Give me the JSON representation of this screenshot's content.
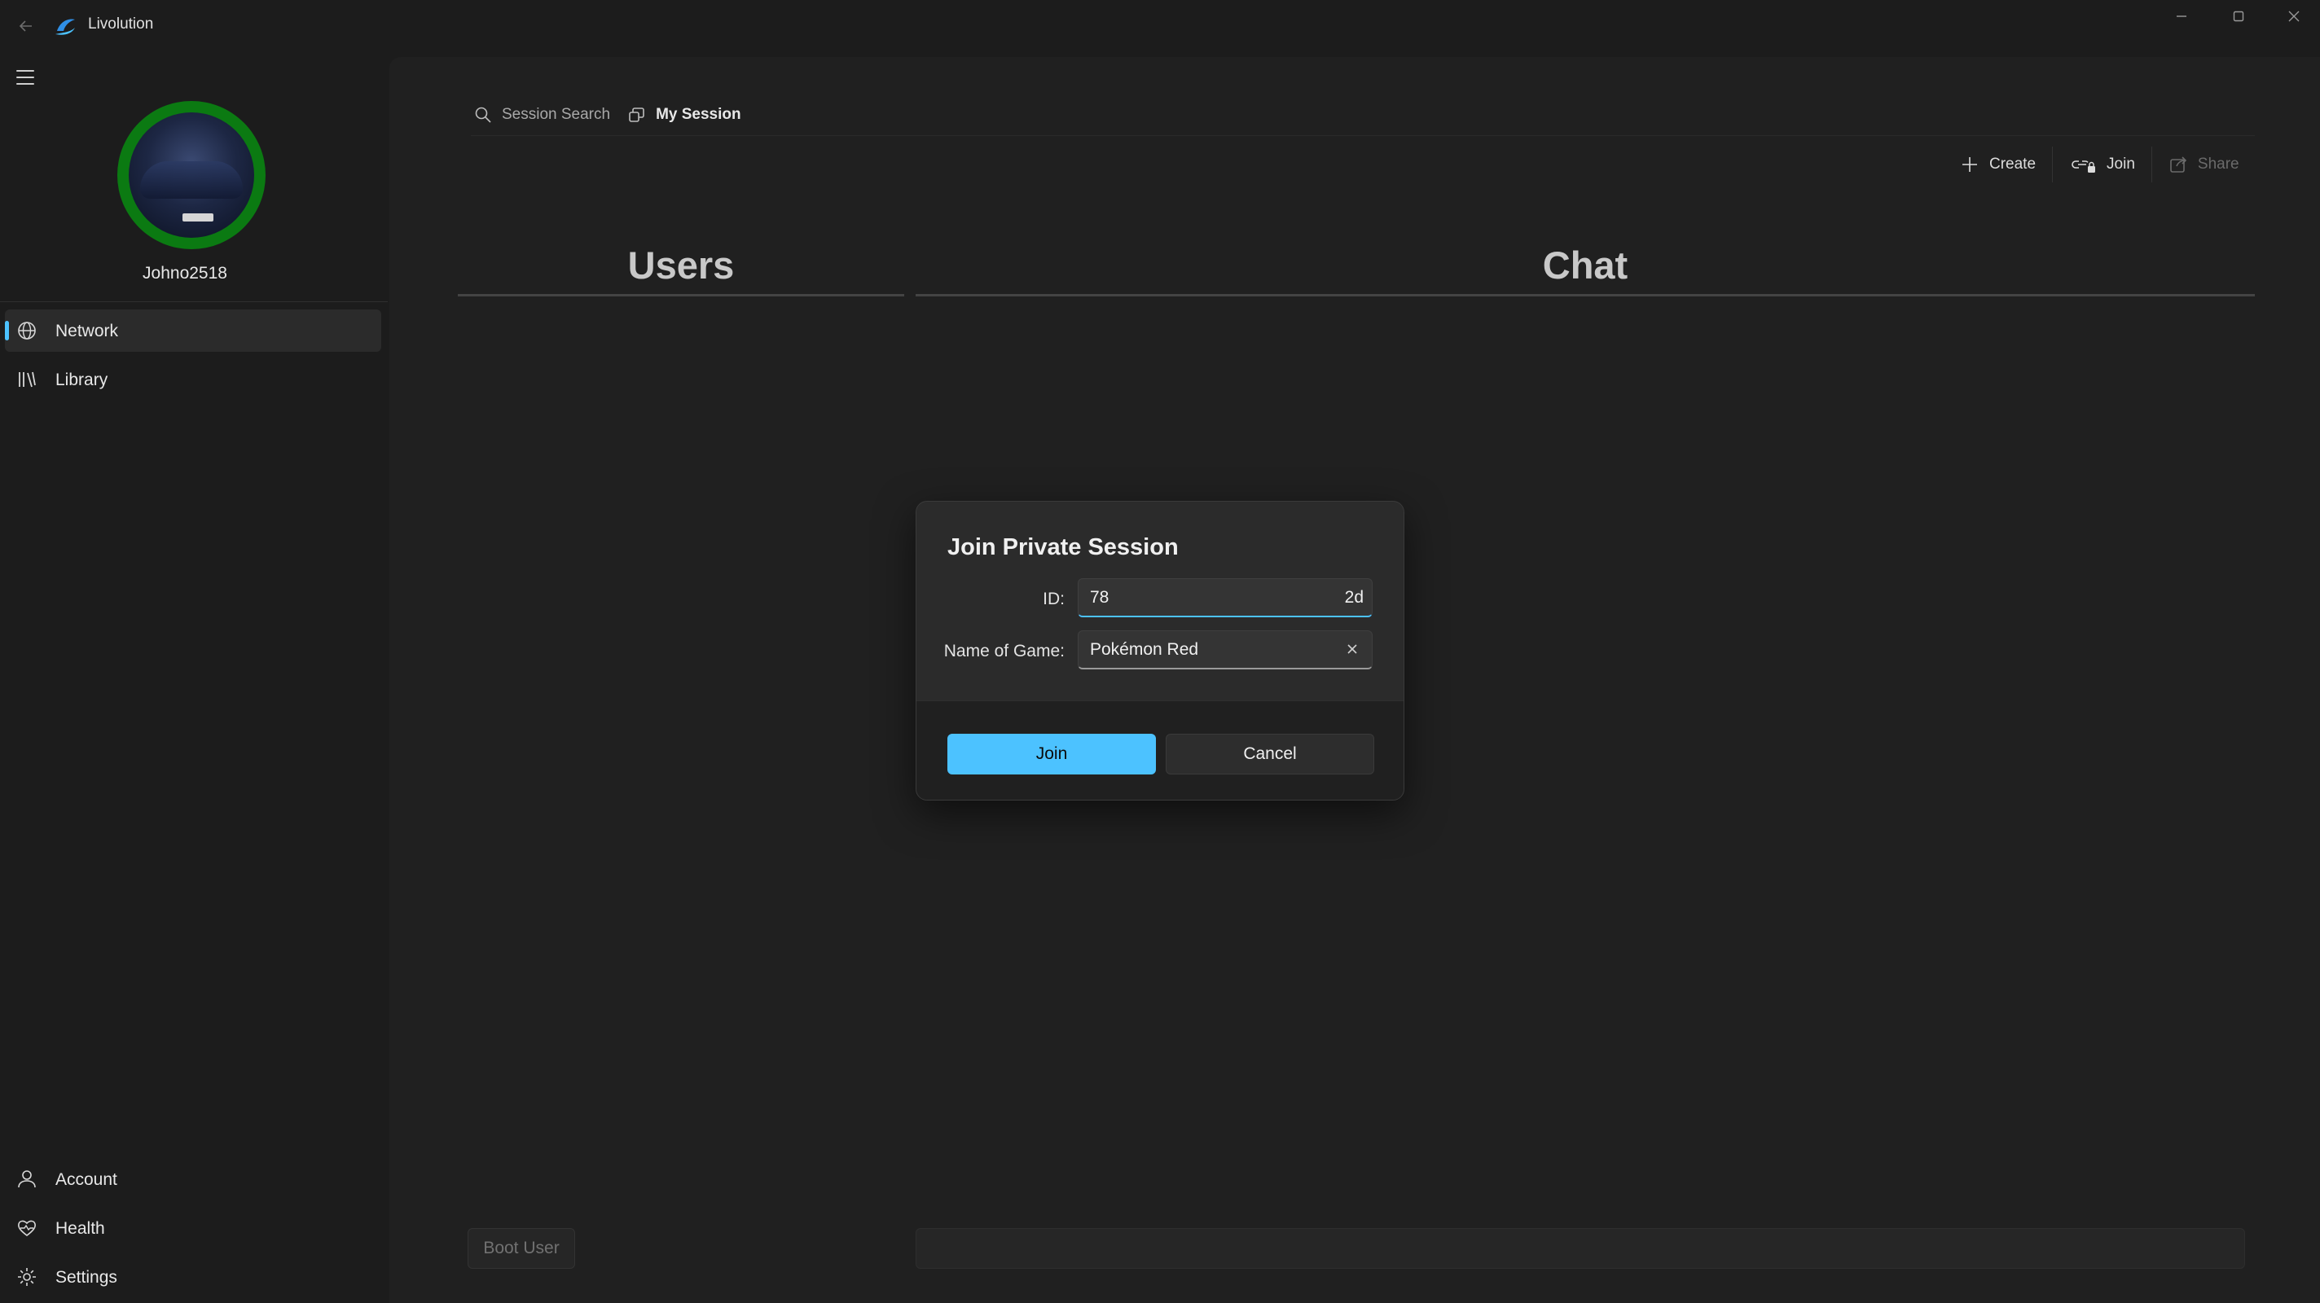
{
  "window": {
    "title": "Livolution",
    "back_icon": "back-arrow-icon",
    "logo_icon": "livolution-logo-icon",
    "controls": [
      "minimize-icon",
      "maximize-icon",
      "close-icon"
    ]
  },
  "sidebar": {
    "menu_icon": "hamburger-icon",
    "username": "Johno2518",
    "avatar_status_color": "#0b7a12",
    "nav_top": [
      {
        "label": "Network",
        "icon": "globe-icon",
        "active": true
      },
      {
        "label": "Library",
        "icon": "library-icon",
        "active": false
      }
    ],
    "nav_bottom": [
      {
        "label": "Account",
        "icon": "person-icon"
      },
      {
        "label": "Health",
        "icon": "heart-pulse-icon"
      },
      {
        "label": "Settings",
        "icon": "gear-icon"
      }
    ]
  },
  "main": {
    "tabs": [
      {
        "label": "Session Search",
        "icon": "search-icon",
        "active": false
      },
      {
        "label": "My Session",
        "icon": "session-icon",
        "active": true
      }
    ],
    "commands": [
      {
        "label": "Create",
        "icon": "plus-icon",
        "enabled": true
      },
      {
        "label": "Join",
        "icon": "link-lock-icon",
        "enabled": true
      },
      {
        "label": "Share",
        "icon": "share-icon",
        "enabled": false
      }
    ],
    "users_header": "Users",
    "chat_header": "Chat",
    "boot_user_label": "Boot User"
  },
  "dialog": {
    "title": "Join Private Session",
    "id_label": "ID:",
    "id_value": "78",
    "id_value_tail": "2d",
    "game_label": "Name of Game:",
    "game_value": "Pokémon Red",
    "join_label": "Join",
    "cancel_label": "Cancel"
  },
  "colors": {
    "accent": "#4cc2ff",
    "background": "#1c1c1c",
    "panel": "#202020"
  }
}
